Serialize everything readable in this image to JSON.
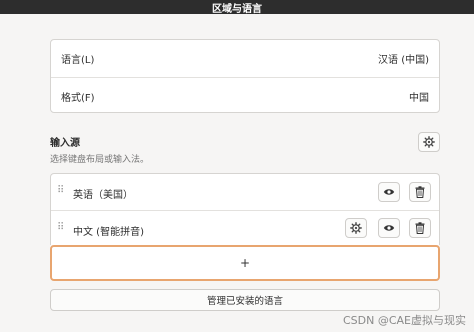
{
  "window": {
    "title": "区域与语言"
  },
  "settings": {
    "language_label": "语言(L)",
    "language_value": "汉语 (中国)",
    "formats_label": "格式(F)",
    "formats_value": "中国"
  },
  "input_sources": {
    "heading": "输入源",
    "description": "选择键盘布局或输入法。",
    "items": [
      {
        "label": "英语（美国）",
        "has_settings": false
      },
      {
        "label": "中文 (智能拼音)",
        "has_settings": true
      }
    ],
    "add_label": "+"
  },
  "manage_button_label": "管理已安装的语言",
  "watermark": "CSDN @CAE虚拟与现实",
  "icons": {
    "settings": "gear-icon",
    "preview": "eye-icon",
    "remove": "trash-icon",
    "drag": "drag-handle-icon",
    "add": "plus-icon"
  },
  "colors": {
    "titlebar": "#2d2d2d",
    "add_highlight": "#e8a56f",
    "background": "#f6f5f4"
  }
}
